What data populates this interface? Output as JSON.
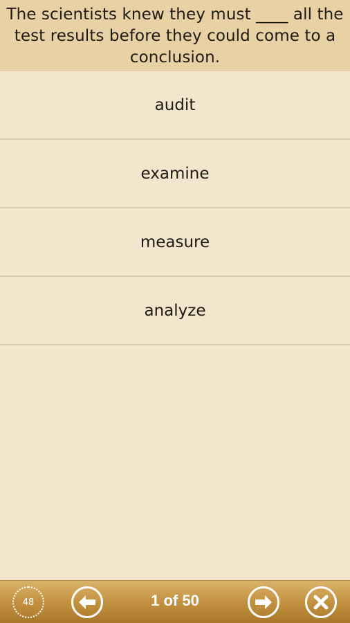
{
  "question": {
    "text": "The scientists knew they must ____ all the test results before they could come to a conclusion."
  },
  "answers": [
    {
      "label": "audit"
    },
    {
      "label": "examine"
    },
    {
      "label": "measure"
    },
    {
      "label": "analyze"
    }
  ],
  "bottom_bar": {
    "timer_value": "48",
    "page_counter": "1 of 50",
    "prev_icon": "arrow-left-circle-icon",
    "next_icon": "arrow-right-circle-icon",
    "close_icon": "close-circle-icon"
  },
  "colors": {
    "background": "#f2e6cc",
    "header": "#e9d1a6",
    "bottom_bar": "#c39241"
  }
}
